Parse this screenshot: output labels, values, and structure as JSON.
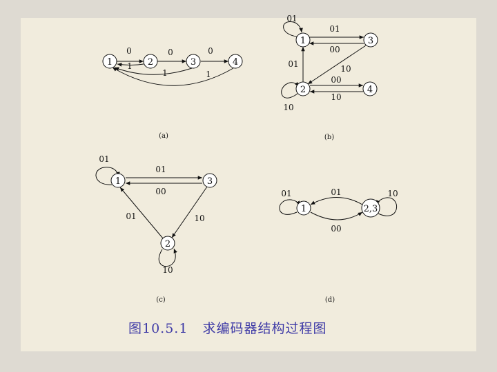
{
  "caption": "图10.5.1   求编码器结构过程图",
  "panels": {
    "a": {
      "label": "(a)",
      "nodes": [
        "1",
        "2",
        "3",
        "4"
      ],
      "edge_labels": [
        "0",
        "0",
        "0",
        "1",
        "1",
        "1"
      ]
    },
    "b": {
      "label": "(b)",
      "nodes": [
        "1",
        "3",
        "2",
        "4"
      ],
      "edge_labels": [
        "01",
        "01",
        "00",
        "01",
        "10",
        "00",
        "10",
        "10"
      ]
    },
    "c": {
      "label": "(c)",
      "nodes": [
        "1",
        "3",
        "2"
      ],
      "edge_labels": [
        "01",
        "01",
        "00",
        "01",
        "10",
        "10"
      ]
    },
    "d": {
      "label": "(d)",
      "nodes": [
        "1",
        "2,3"
      ],
      "edge_labels": [
        "01",
        "01",
        "10",
        "00"
      ]
    }
  },
  "colors": {
    "caption": "#3e3aa6",
    "background": "#f1ecdd",
    "border": "#dedad2"
  }
}
